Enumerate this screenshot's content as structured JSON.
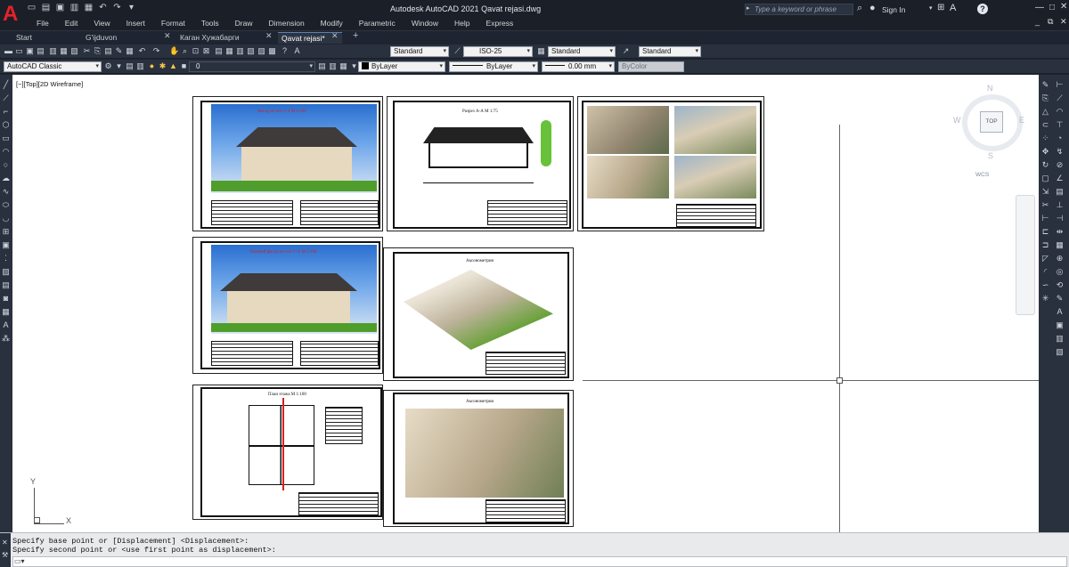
{
  "app": {
    "logo": "A",
    "title": "Autodesk AutoCAD 2021   Qavat rejasi.dwg",
    "search_placeholder": "Type a keyword or phrase",
    "sign_in": "Sign In"
  },
  "menu": [
    "File",
    "Edit",
    "View",
    "Insert",
    "Format",
    "Tools",
    "Draw",
    "Dimension",
    "Modify",
    "Parametric",
    "Window",
    "Help",
    "Express"
  ],
  "tabs": [
    {
      "label": "Start"
    },
    {
      "label": "G'ijduvon Toposiyomka*"
    },
    {
      "label": "Каган Хужабарги 555217*"
    },
    {
      "label": "Qavat rejasi*"
    }
  ],
  "toolbar1": {
    "text_style": "Standard",
    "dim_style": "ISO-25",
    "table_style": "Standard",
    "mleader_style": "Standard"
  },
  "toolbar2": {
    "workspace": "AutoCAD Classic",
    "layer": "0",
    "color": "ByLayer",
    "linetype": "ByLayer",
    "lineweight": "0.00 mm",
    "plotstyle": "ByColor"
  },
  "viewport": {
    "label": "[−][Top][2D Wireframe]"
  },
  "viewcube": {
    "top": "TOP",
    "north": "N",
    "south": "S",
    "east": "E",
    "west": "W",
    "wcs": "WCS"
  },
  "ucs": {
    "x": "X",
    "y": "Y"
  },
  "sheets": {
    "elevation1_title": "Фасад по оси 1-4  М 1:100",
    "section_title": "Разрез А-А М 1:75",
    "elevation2_title": "Боковой фасад по оси 1'-4'  М 1:100",
    "axo1_title": "Аксонометрия",
    "plan_title": "План этажа М 1:100",
    "axo2_title": "Аксонометрия"
  },
  "command": {
    "line1": "Specify base point or [Displacement] <Displacement>:",
    "line2": "Specify second point or <use first point as displacement>:",
    "input": ""
  }
}
